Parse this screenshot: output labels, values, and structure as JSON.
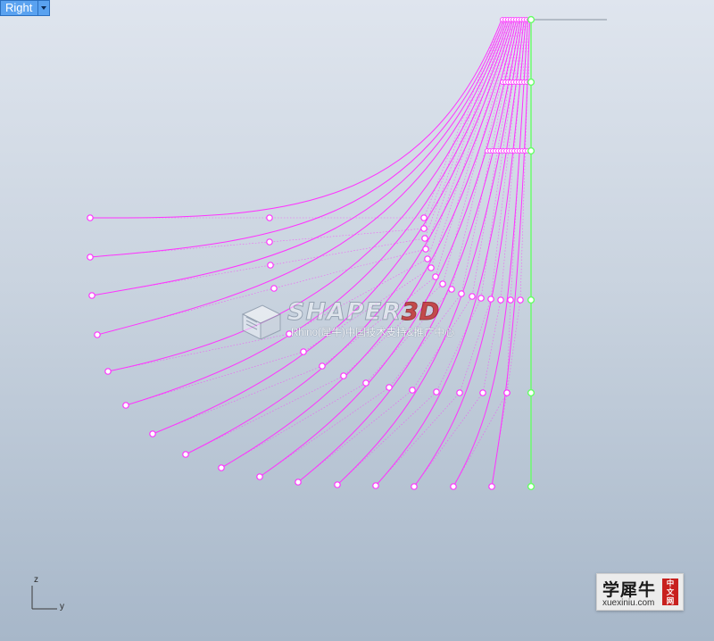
{
  "viewport": {
    "name": "Right"
  },
  "watermark": {
    "title_main": "SHAPER",
    "title_accent": "3D",
    "subtitle": "Rhino(犀牛)中国技术支持&推广中心"
  },
  "axes": {
    "vertical": "z",
    "horizontal": "y"
  },
  "brand": {
    "name": "学犀牛",
    "tag": "中文网",
    "url": "xuexiniu.com"
  },
  "colors": {
    "curve": "#ff33ff",
    "control_point_selected": "#66ff66",
    "axis_line": "#9aa4b0",
    "watermark_accent": "#c32323",
    "brand_tag": "#c8201e"
  }
}
